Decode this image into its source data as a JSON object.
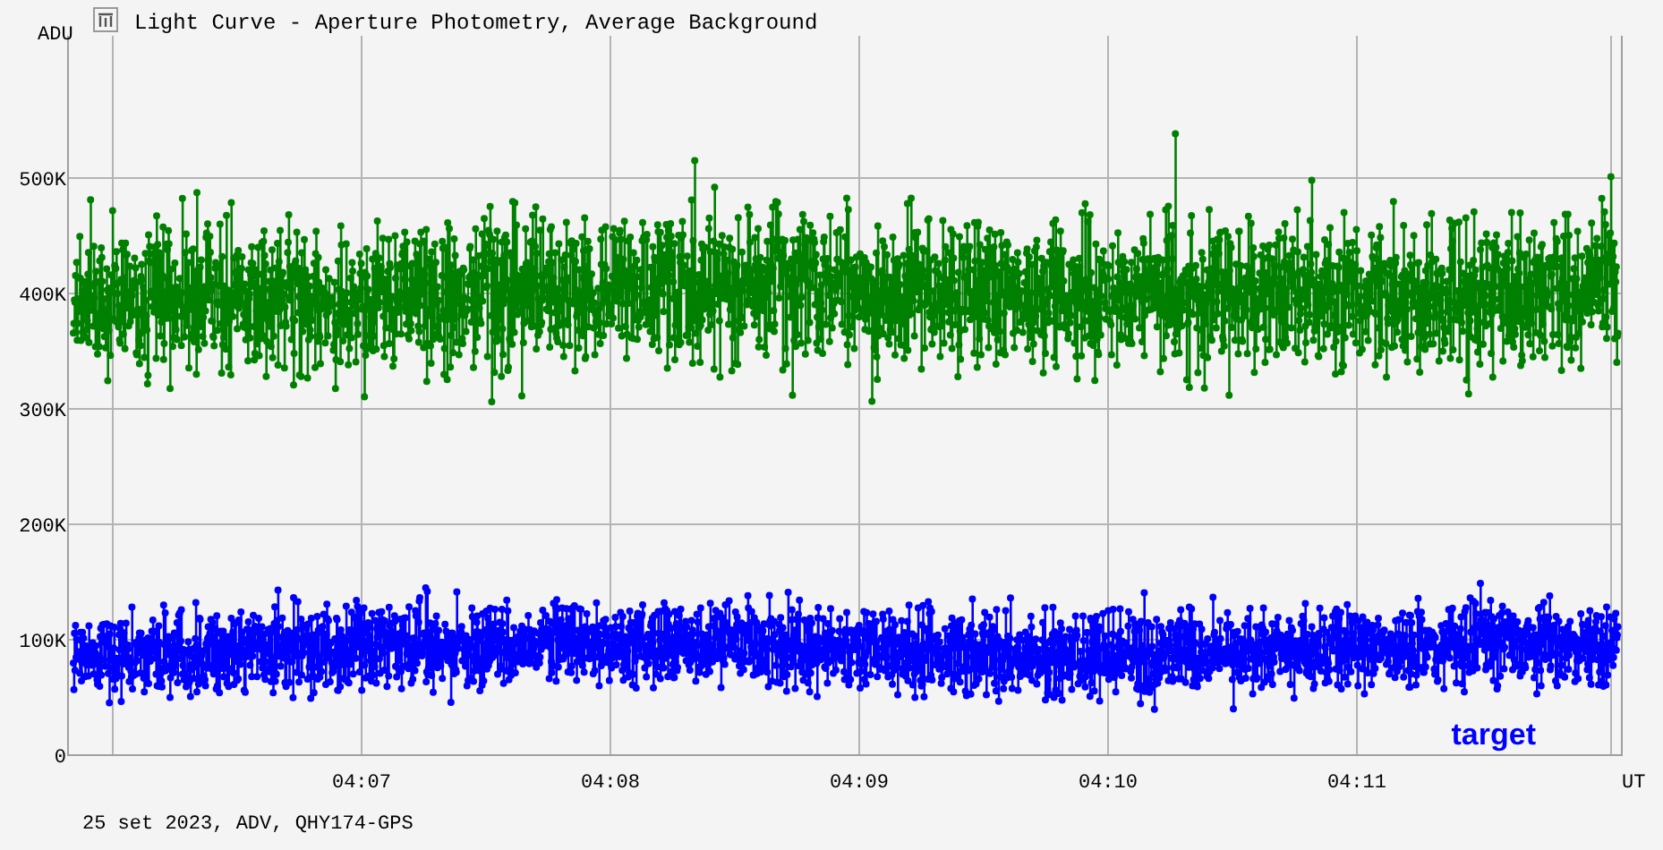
{
  "window": {
    "title": "Light Curve - Aperture Photometry, Average Background"
  },
  "y_axis": {
    "unit": "ADU",
    "ticks": [
      "500K",
      "400K",
      "300K",
      "200K",
      "100K",
      "0"
    ]
  },
  "x_axis": {
    "unit": "UT",
    "ticks": [
      "04:07",
      "04:08",
      "04:09",
      "04:10",
      "04:11"
    ]
  },
  "series": [
    {
      "color": "#008000"
    },
    {
      "color": "#0000ff",
      "label": "target"
    }
  ],
  "footer": "25 set 2023, ADV, QHY174-GPS"
}
